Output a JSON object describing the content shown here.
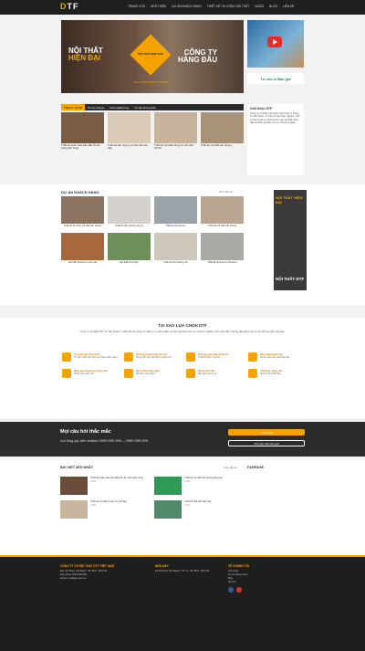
{
  "header": {
    "logo_a": "D",
    "logo_b": "TF",
    "nav": [
      "Trang chủ",
      "Giới thiệu",
      "Dự án khách hàng",
      "Thiết kế thi công nội thất",
      "Video",
      "Blog",
      "Liên hệ"
    ]
  },
  "banner": {
    "left1": "NỘI THẤT",
    "left2": "HIỆN ĐẠI",
    "right1": "CÔNG TY",
    "right2": "HÀNG ĐẦU",
    "diamond": "NỘI THẤT ĐẸP DTF",
    "sub": "CƠ HUẤN 0912 927 88 088"
  },
  "advise": "Tư vấn & Báo giá",
  "tabs": [
    "Thiết kế nội thất",
    "Tin tức công ty",
    "Kinh nghiệm hay",
    "Tư vấn phong thủy"
  ],
  "news": [
    "Thiết kế quán cafe kiểu Bắc Âu ấn tượng ấm cúng",
    "Thiết kế căn chung cư hiện đại cao cấp",
    "Thiết kế nội thất chung cư nhỏ đẹp tinh tế",
    "Thiết kế nội thất văn phòng"
  ],
  "intro": {
    "title": "Giới thiệu DTF",
    "text": "Công ty cổ phần DTF được thành lập từ tháng 11 năm 2010. Với hơn 8 năm kinh nghiệm, DTF tự hào là đơn vị thiết kế thi công nội thất hàng đầu với đội ngũ kiến trúc sư chuyên nghiệp."
  },
  "projects": {
    "title": "Dự án khách hàng",
    "more": "Xem tất cả",
    "items": [
      "Thiết kế thi công nội thất văn phòng",
      "Thiết kế văn phòng công ty",
      "Thiết kế showroom",
      "Thiết kế nội thất văn phòng",
      "Nội thất showroom cao cấp",
      "Nội thất trung tâm",
      "Thiết kế văn phòng mở",
      "Thiết kế showroom Dentium"
    ],
    "ad1": "NỘI THẤT HIỆN ĐẠI",
    "ad2": "NỘI THẤT DTF"
  },
  "why": {
    "title": "Tại sao lựa chọn DTF",
    "desc": "Công ty cổ phần DTF tự hào là đơn vị thiết kế thi công nội thất uy tín hàng đầu với đội ngũ kiến trúc sư chuyên nghiệp, luôn đem đến những giải pháp tối ưu cho không gian của bạn.",
    "items": [
      [
        "Tư vấn tận tâm 24/7",
        "Tư vấn nhiệt tình theo yêu cầu khách hàng"
      ],
      [
        "Không phát sinh chi phí",
        "Chúng tôi cam kết không phát sinh"
      ],
      [
        "Không giới hạn thiết kế",
        "Thiết kế theo ý tưởng"
      ],
      [
        "Bảo hành dài hạn",
        "Chính sách bảo hành lâu dài"
      ],
      [
        "Bảo giá Concept miễn phí",
        "Hoàn toàn miễn phí"
      ],
      [
        "Quy trình làm việc",
        "Rõ ràng minh bạch"
      ],
      [
        "Đúng tiến độ",
        "Bàn giao đúng hẹn"
      ],
      [
        "Thiết kế sáng tạo",
        "Phong cách độc đáo"
      ]
    ]
  },
  "faq": {
    "title": "Mọi câu hỏi thắc mắc",
    "desc": "Vui lòng gọi đến hotline 0999.999.999 – 0999.999.999",
    "btn1": "Gửi email",
    "btn2": "Gửi yêu cầu báo giá"
  },
  "latest": {
    "title": "Bài viết mới nhất",
    "more": "Xem tất cả",
    "fanpage": "Fanpage",
    "items": [
      [
        "Thiết kế quán cafe kiểu Bắc Âu ấn tượng ấm cúng",
        "15/01"
      ],
      [
        "Thiết kế nội thất văn phòng sáng tạo",
        "14/01"
      ],
      [
        "Thiết kế nội thất chung cư nhỏ đẹp",
        "13/01"
      ],
      [
        "Thiết kế nhà phố hiện đại",
        "12/01"
      ]
    ]
  },
  "footer": {
    "c1h": "Công ty CP Nội thất DTF Việt Nam",
    "c1": [
      "Địa chỉ: Phạm Văn Bạch, Tân Bình, TP.HCM",
      "Điện thoại: 0999.999.999",
      "Email: email@gmail.com"
    ],
    "c2h": "Nhà máy",
    "c2": [
      "Số 36 Phạm Văn Bạch, P.15, Q. Tân Bình, TP.HCM"
    ],
    "c3h": "Về chúng tôi",
    "c3": [
      "Giới thiệu",
      "Dự án khách hàng",
      "Blog",
      "Liên hệ"
    ]
  },
  "colors": {
    "accent": "#f4a300",
    "dark": "#1f1f1f"
  }
}
